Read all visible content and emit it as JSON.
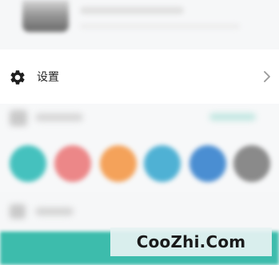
{
  "settings": {
    "label": "设置",
    "icon": "gear-icon",
    "chevron_icon": "chevron-right-icon"
  },
  "theme": {
    "swatch_colors": [
      "#45c1be",
      "#ec8788",
      "#f4a25a",
      "#4fb1d4",
      "#4a8ed2",
      "#8a8a8a"
    ]
  },
  "colors": {
    "accent": "#3dbcac",
    "text": "#222222",
    "chevron": "#9a9a9a"
  },
  "watermark": {
    "text": "CooZhi.Com"
  }
}
